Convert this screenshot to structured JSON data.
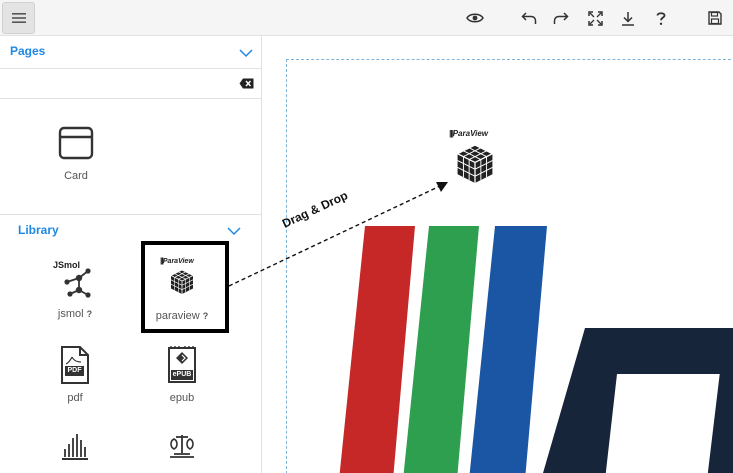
{
  "toolbar": {
    "icons": [
      "menu-icon",
      "eye-icon",
      "undo-icon",
      "redo-icon",
      "fullscreen-icon",
      "download-icon",
      "help-icon",
      "save-icon"
    ]
  },
  "sidebar": {
    "pages": {
      "title": "Pages",
      "search_value": "",
      "items": [
        {
          "label": "Card",
          "icon": "card-icon"
        }
      ]
    },
    "library": {
      "title": "Library",
      "items": [
        {
          "label": "jsmol",
          "icon_text": "JSmol",
          "help": "?"
        },
        {
          "label": "paraview",
          "icon_text": "ParaView",
          "help": "?"
        },
        {
          "label": "pdf",
          "icon_text": "PDF"
        },
        {
          "label": "epub",
          "icon_text": "ePUB"
        },
        {
          "label": "",
          "icon": "spectrum-icon"
        },
        {
          "label": "",
          "icon": "balance-icon"
        }
      ]
    }
  },
  "annotation": {
    "drag_label": "Drag & Drop",
    "drop_logo_text": "ParaView"
  },
  "colors": {
    "accent": "#1e88e5",
    "logo_red": "#c62828",
    "logo_green": "#2e9e4f",
    "logo_blue": "#1a56a4",
    "logo_dark": "#16253a"
  }
}
